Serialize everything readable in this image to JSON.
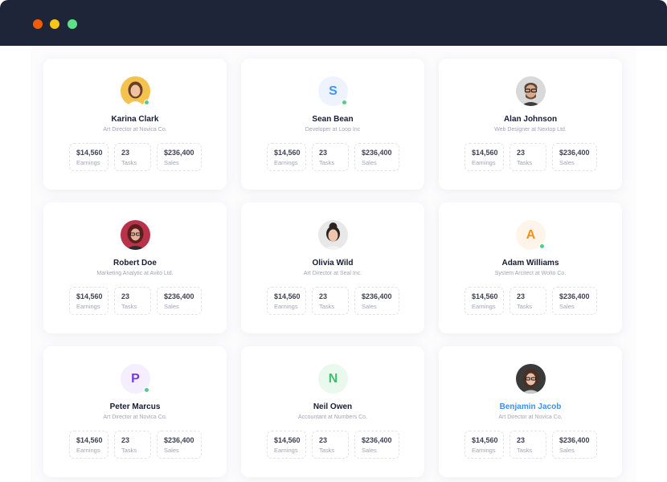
{
  "window": {
    "controls": [
      "close",
      "minimize",
      "maximize"
    ]
  },
  "colors": {
    "bar": "#1e2538",
    "close": "#f25c05",
    "minimize": "#f5c518",
    "maximize": "#5ee086",
    "online": "#50cd89",
    "link": "#3b8ff5"
  },
  "cards": [
    {
      "name": "Karina Clark",
      "role": "Art Director at Novica Co.",
      "avatar": {
        "type": "photo",
        "description": "woman-portrait"
      },
      "online": true,
      "stats": [
        {
          "value": "$14,560",
          "label": "Earnings"
        },
        {
          "value": "23",
          "label": "Tasks"
        },
        {
          "value": "$236,400",
          "label": "Sales"
        }
      ]
    },
    {
      "name": "Sean Bean",
      "role": "Developer at Loop Inc",
      "avatar": {
        "type": "initial",
        "initial": "S",
        "bg": "#eef3ff",
        "fg": "#3e97ff"
      },
      "online": true,
      "stats": [
        {
          "value": "$14,560",
          "label": "Earnings"
        },
        {
          "value": "23",
          "label": "Tasks"
        },
        {
          "value": "$236,400",
          "label": "Sales"
        }
      ]
    },
    {
      "name": "Alan Johnson",
      "role": "Web Designer at Nextop Ltd.",
      "avatar": {
        "type": "photo",
        "description": "man-portrait"
      },
      "online": false,
      "stats": [
        {
          "value": "$14,560",
          "label": "Earnings"
        },
        {
          "value": "23",
          "label": "Tasks"
        },
        {
          "value": "$236,400",
          "label": "Sales"
        }
      ]
    },
    {
      "name": "Robert Doe",
      "role": "Marketing Analytic at Avito Ltd.",
      "avatar": {
        "type": "photo",
        "description": "woman-portrait"
      },
      "online": false,
      "stats": [
        {
          "value": "$14,560",
          "label": "Earnings"
        },
        {
          "value": "23",
          "label": "Tasks"
        },
        {
          "value": "$236,400",
          "label": "Sales"
        }
      ]
    },
    {
      "name": "Olivia Wild",
      "role": "Art Director at Seal Inc.",
      "avatar": {
        "type": "photo",
        "description": "woman-portrait"
      },
      "online": false,
      "stats": [
        {
          "value": "$14,560",
          "label": "Earnings"
        },
        {
          "value": "23",
          "label": "Tasks"
        },
        {
          "value": "$236,400",
          "label": "Sales"
        }
      ]
    },
    {
      "name": "Adam Williams",
      "role": "System Arcitect at Wolto Co.",
      "avatar": {
        "type": "initial",
        "initial": "A",
        "bg": "#fff4ea",
        "fg": "#f1911f"
      },
      "online": true,
      "stats": [
        {
          "value": "$14,560",
          "label": "Earnings"
        },
        {
          "value": "23",
          "label": "Tasks"
        },
        {
          "value": "$236,400",
          "label": "Sales"
        }
      ]
    },
    {
      "name": "Peter Marcus",
      "role": "Art Director at Novica Co.",
      "avatar": {
        "type": "initial",
        "initial": "P",
        "bg": "#f5eeff",
        "fg": "#7239ea"
      },
      "online": true,
      "stats": [
        {
          "value": "$14,560",
          "label": "Earnings"
        },
        {
          "value": "23",
          "label": "Tasks"
        },
        {
          "value": "$236,400",
          "label": "Sales"
        }
      ]
    },
    {
      "name": "Neil Owen",
      "role": "Accountant at Numbers Co.",
      "avatar": {
        "type": "initial",
        "initial": "N",
        "bg": "#e9f9ee",
        "fg": "#3fbf6e"
      },
      "online": false,
      "stats": [
        {
          "value": "$14,560",
          "label": "Earnings"
        },
        {
          "value": "23",
          "label": "Tasks"
        },
        {
          "value": "$236,400",
          "label": "Sales"
        }
      ]
    },
    {
      "name": "Benjamin Jacob",
      "role": "Art Director at Novica Co.",
      "avatar": {
        "type": "photo",
        "description": "woman-portrait"
      },
      "online": false,
      "highlighted": true,
      "stats": [
        {
          "value": "$14,560",
          "label": "Earnings"
        },
        {
          "value": "23",
          "label": "Tasks"
        },
        {
          "value": "$236,400",
          "label": "Sales"
        }
      ]
    }
  ]
}
